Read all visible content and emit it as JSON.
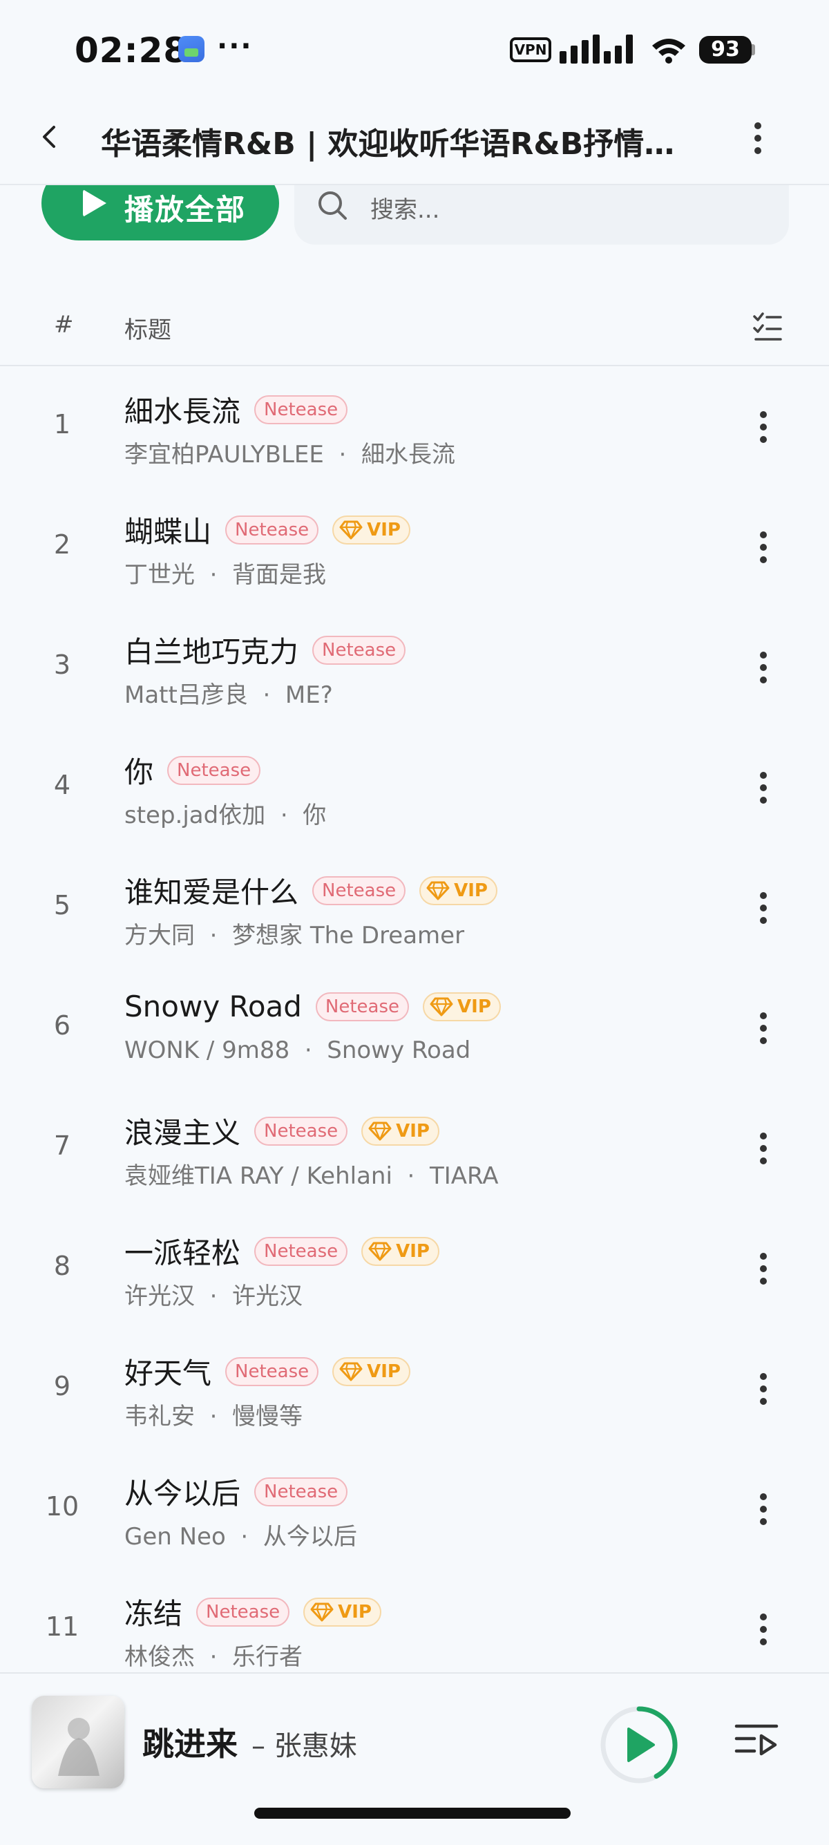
{
  "status_bar": {
    "time": "02:28",
    "dots": "···",
    "vpn": "VPN",
    "battery": "93"
  },
  "header": {
    "title": "华语柔情R&B | 欢迎收听华语R&B抒情…"
  },
  "actions": {
    "play_all_label": "播放全部",
    "search_placeholder": "搜索..."
  },
  "columns": {
    "index": "#",
    "title": "标题"
  },
  "tags": {
    "netease": "Netease",
    "vip": "VIP"
  },
  "songs": [
    {
      "index": "1",
      "title": "細水長流",
      "netease": true,
      "vip": false,
      "artist": "李宜柏PAULYBLEE",
      "album": "細水長流"
    },
    {
      "index": "2",
      "title": "蝴蝶山",
      "netease": true,
      "vip": true,
      "artist": "丁世光",
      "album": "背面是我"
    },
    {
      "index": "3",
      "title": "白兰地巧克力",
      "netease": true,
      "vip": false,
      "artist": "Matt吕彦良",
      "album": "ME?"
    },
    {
      "index": "4",
      "title": "你",
      "netease": true,
      "vip": false,
      "artist": "step.jad依加",
      "album": "你"
    },
    {
      "index": "5",
      "title": "谁知爱是什么",
      "netease": true,
      "vip": true,
      "artist": "方大同",
      "album": "梦想家 The Dreamer"
    },
    {
      "index": "6",
      "title": "Snowy Road",
      "netease": true,
      "vip": true,
      "artist": "WONK / 9m88",
      "album": "Snowy Road"
    },
    {
      "index": "7",
      "title": "浪漫主义",
      "netease": true,
      "vip": true,
      "artist": "袁娅维TIA RAY / Kehlani",
      "album": "TIARA"
    },
    {
      "index": "8",
      "title": "一派轻松",
      "netease": true,
      "vip": true,
      "artist": "许光汉",
      "album": "许光汉"
    },
    {
      "index": "9",
      "title": "好天气",
      "netease": true,
      "vip": true,
      "artist": "韦礼安",
      "album": "慢慢等"
    },
    {
      "index": "10",
      "title": "从今以后",
      "netease": true,
      "vip": false,
      "artist": "Gen Neo",
      "album": "从今以后"
    },
    {
      "index": "11",
      "title": "冻结",
      "netease": true,
      "vip": true,
      "artist": "林俊杰",
      "album": "乐行者"
    }
  ],
  "now_playing": {
    "title": "跳进来",
    "artist": "– 张惠妹",
    "progress": 0.42
  },
  "colors": {
    "accent": "#1fa463",
    "netease_tag": "#e06a75",
    "vip_tag": "#ef9a14",
    "background": "#f6f9fc"
  },
  "icons": {
    "back": "chevron-left-icon",
    "more": "more-vertical-icon",
    "search": "search-icon",
    "play": "play-icon",
    "multiselect": "checklist-icon",
    "vip": "diamond-icon",
    "queue": "playlist-icon"
  }
}
